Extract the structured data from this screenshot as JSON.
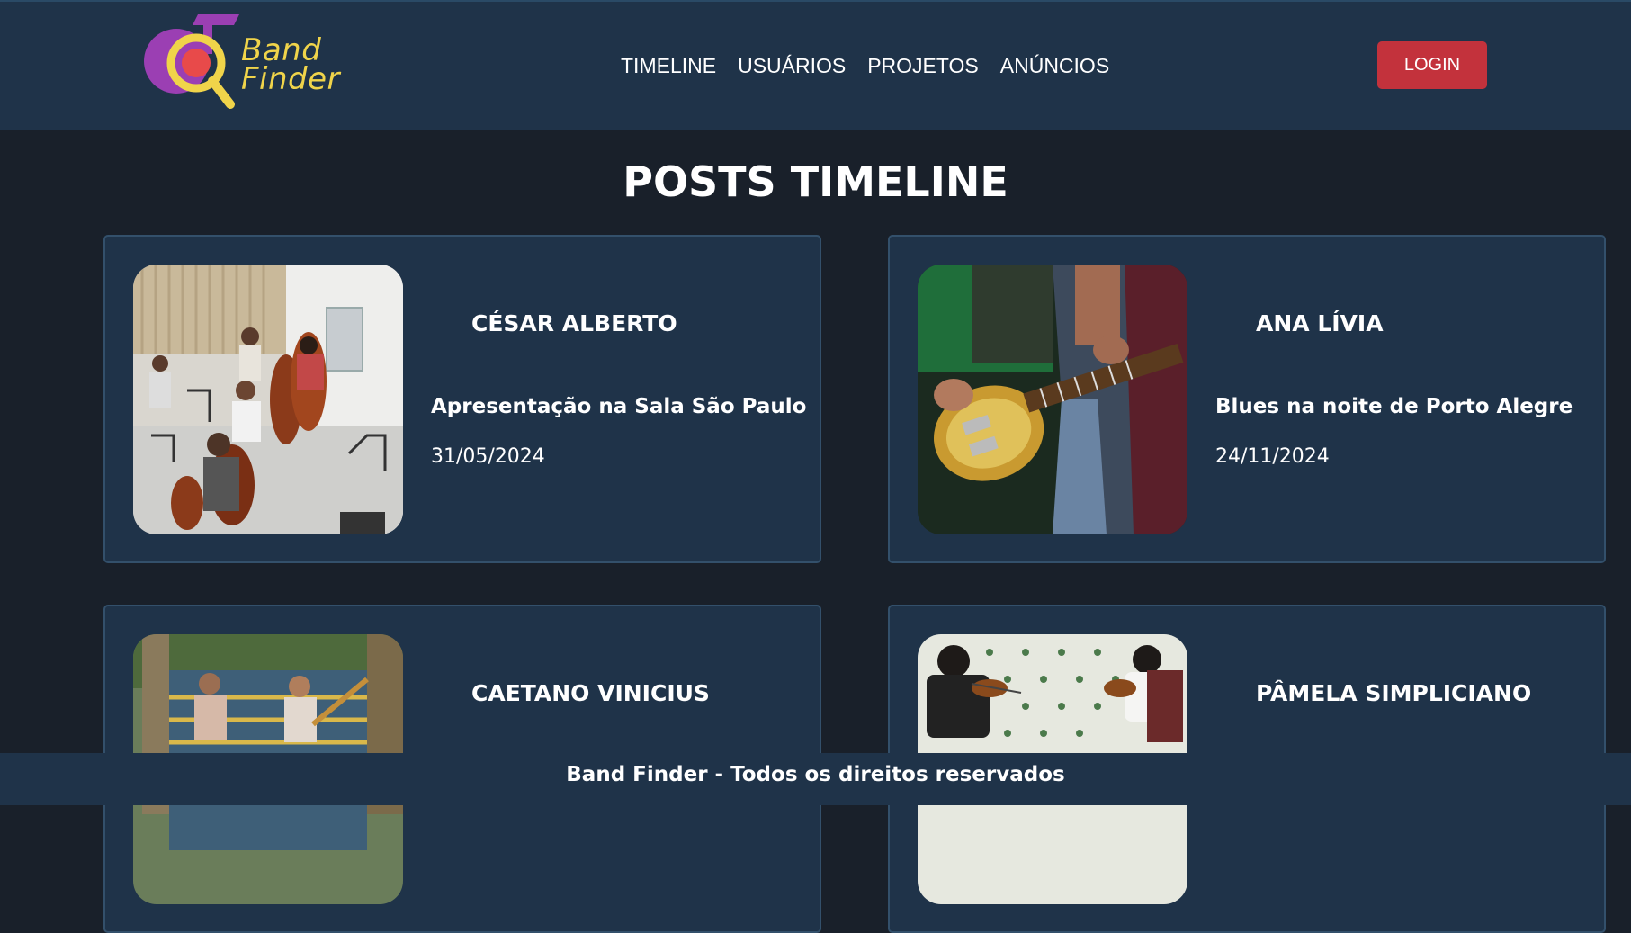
{
  "header": {
    "logo": {
      "line1": "Band",
      "line2": "Finder"
    },
    "nav": [
      "TIMELINE",
      "USUÁRIOS",
      "PROJETOS",
      "ANÚNCIOS"
    ],
    "login_label": "LOGIN"
  },
  "main": {
    "title": "POSTS TIMELINE",
    "posts": [
      {
        "author": "CÉSAR ALBERTO",
        "title": "Apresentação na Sala São Paulo",
        "date": "31/05/2024",
        "image": "orchestra-rehearsal-photo"
      },
      {
        "author": "ANA LÍVIA",
        "title": "Blues na noite de Porto Alegre",
        "date": "24/11/2024",
        "image": "electric-guitar-player-photo"
      },
      {
        "author": "CAETANO VINICIUS",
        "title": "",
        "date": "",
        "image": "band-on-stairs-photo"
      },
      {
        "author": "PÂMELA SIMPLICIANO",
        "title": "",
        "date": "",
        "image": "violin-duo-photo"
      }
    ]
  },
  "footer": {
    "text": "Band Finder - Todos os direitos reservados"
  },
  "colors": {
    "header_bg": "#1f3349",
    "page_bg": "#19202a",
    "login_bg": "#c3323c",
    "logo_yellow": "#f0d44a"
  }
}
